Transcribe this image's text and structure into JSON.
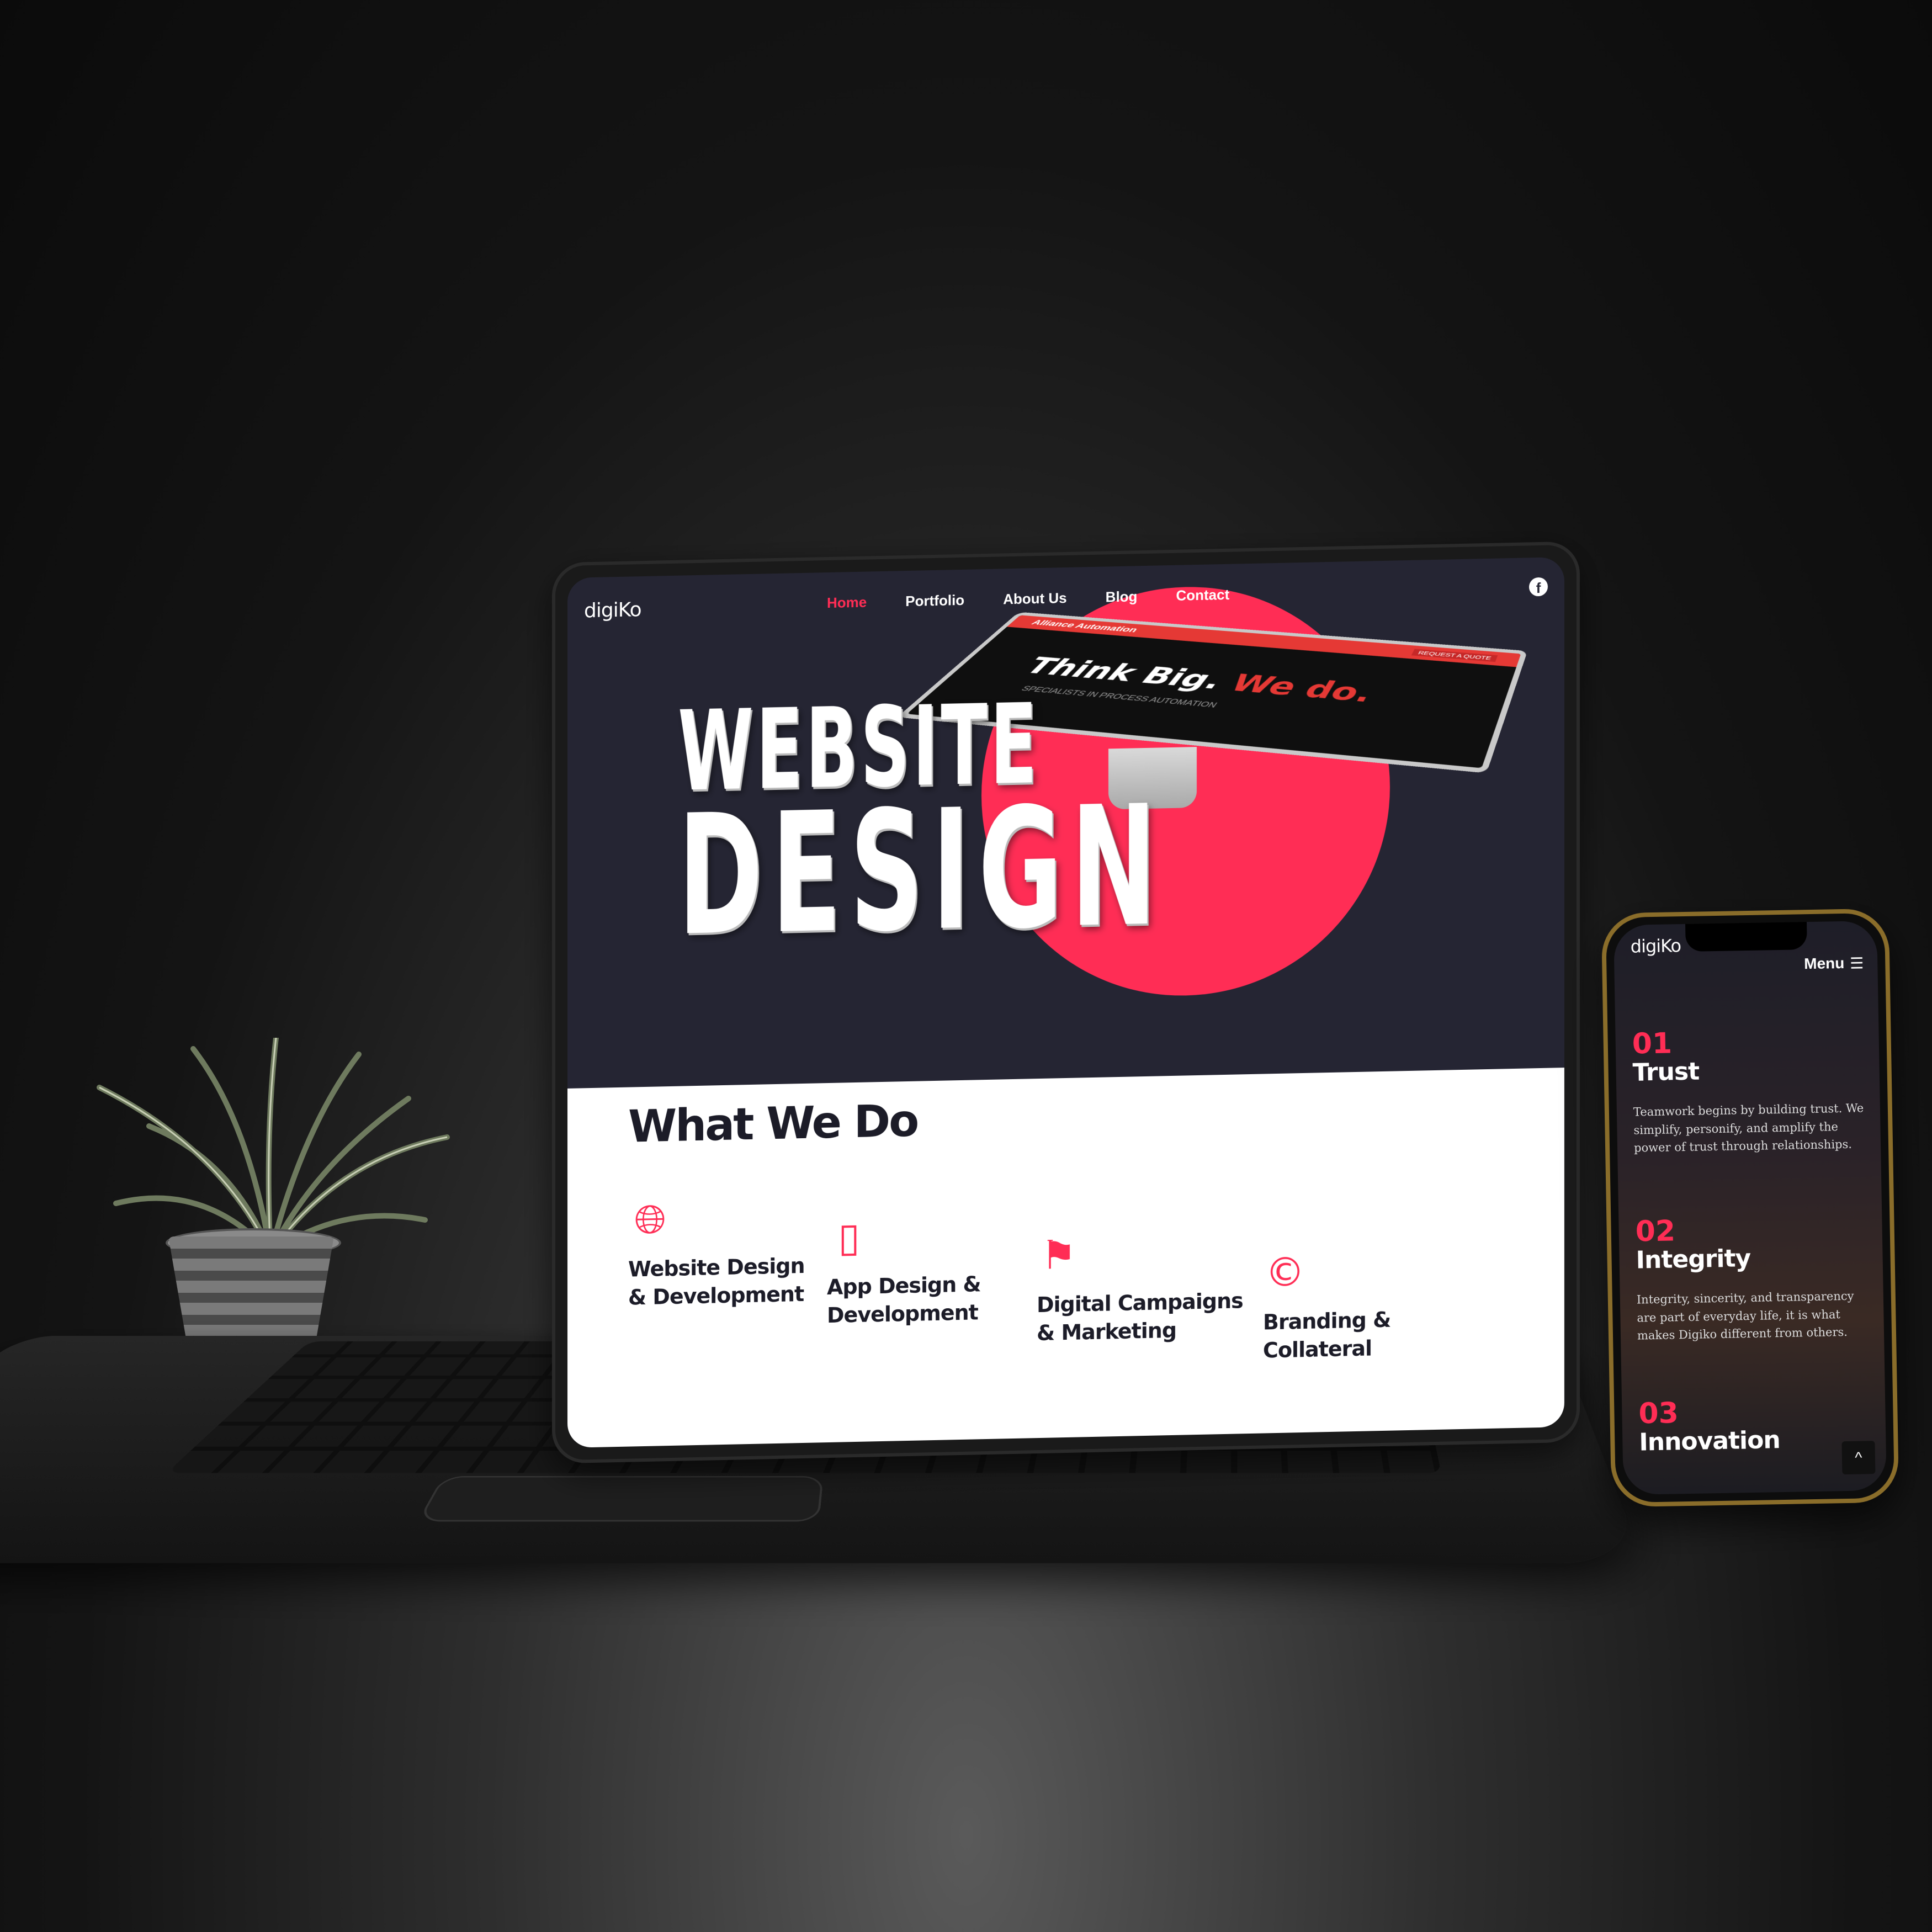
{
  "laptop": {
    "logo": "digiKo",
    "nav": [
      "Home",
      "Portfolio",
      "About Us",
      "Blog",
      "Contact"
    ],
    "active_nav": "Home",
    "social_icon": "facebook-icon",
    "hero": {
      "line1": "WEBSITE",
      "line2": "DESIGN"
    },
    "mockup": {
      "logo": "Alliance Automation",
      "headline_white": "Think Big.",
      "headline_red": "We do.",
      "subtext": "SPECIALISTS IN PROCESS AUTOMATION",
      "cta": "REQUEST A QUOTE"
    },
    "section_title": "What We Do",
    "services": [
      {
        "icon": "globe-icon",
        "label": "Website Design & Development"
      },
      {
        "icon": "devices-icon",
        "label": "App Design & Development"
      },
      {
        "icon": "runner-icon",
        "label": "Digital Campaigns & Marketing"
      },
      {
        "icon": "copyright-icon",
        "label": "Branding & Collateral"
      }
    ]
  },
  "phone": {
    "logo": "digiKo",
    "menu_label": "Menu",
    "values": [
      {
        "num": "01",
        "title": "Trust",
        "body": "Teamwork begins by building trust. We simplify, personify, and amplify the power of trust through relationships."
      },
      {
        "num": "02",
        "title": "Integrity",
        "body": "Integrity, sincerity, and transparency are part of everyday life, it is what makes Digiko different from others."
      },
      {
        "num": "03",
        "title": "Innovation",
        "body": ""
      }
    ],
    "scroll_top": "^"
  },
  "colors": {
    "accent": "#ff2d55",
    "hero_bg": "#252533",
    "services_bg": "#ffffff",
    "phone_frame": "#8a6d2a"
  }
}
